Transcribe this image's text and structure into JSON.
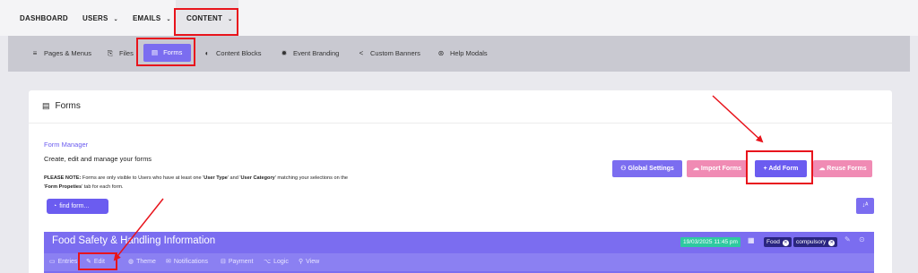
{
  "topnav": {
    "items": [
      {
        "label": "DASHBOARD",
        "chevron": false
      },
      {
        "label": "USERS",
        "chevron": true
      },
      {
        "label": "EMAILS",
        "chevron": true
      },
      {
        "label": "CONTENT",
        "chevron": true
      }
    ]
  },
  "subnav": {
    "items": [
      {
        "label": "Pages & Menus",
        "icon": "list-icon"
      },
      {
        "label": "Files",
        "icon": "files-icon"
      },
      {
        "label": "Forms",
        "icon": "form-icon"
      },
      {
        "label": "Content Blocks",
        "icon": "blocks-icon"
      },
      {
        "label": "Event Branding",
        "icon": "gear-icon"
      },
      {
        "label": "Custom Banners",
        "icon": "share-icon"
      },
      {
        "label": "Help Modals",
        "icon": "help-icon"
      }
    ]
  },
  "card": {
    "title": "Forms",
    "manager_title": "Form Manager",
    "manager_subtitle": "Create, edit and manage your forms",
    "note_prefix": "PLEASE NOTE:",
    "note_text_1": " Forms are only visible to Users who have at least one '",
    "note_user_type": "User Type",
    "note_text_2": "' and '",
    "note_user_category": "User Category",
    "note_text_3": "' matching your selections on the",
    "note_text_4": "'",
    "note_form_properties": "Form Propeties",
    "note_text_5": "' tab for each form."
  },
  "search": {
    "placeholder": "find form..."
  },
  "buttons": {
    "global_settings": "Global Settings",
    "import_forms": "Import Forms",
    "add_form": "+ Add Form",
    "reuse_forms": "Reuse Forms",
    "sort": "↓ᴬ"
  },
  "form_row": {
    "name": "Food Safety & Handling Information",
    "date": "19/03/2025 11:45 pm",
    "tags": [
      "Food",
      "compulsory"
    ],
    "actions": [
      {
        "label": "Entries",
        "icon": "entries-icon"
      },
      {
        "label": "Edit",
        "icon": "pencil-icon"
      },
      {
        "label": "Theme",
        "icon": "theme-icon"
      },
      {
        "label": "Notifications",
        "icon": "envelope-icon"
      },
      {
        "label": "Payment",
        "icon": "payment-icon"
      },
      {
        "label": "Logic",
        "icon": "logic-icon"
      },
      {
        "label": "View",
        "icon": "search-icon"
      }
    ]
  },
  "colors": {
    "accent": "#7b6df0",
    "pink": "#f08bb4",
    "highlight": "#e8141c",
    "date_badge": "#2ec9a0",
    "tag": "#2a2580"
  }
}
